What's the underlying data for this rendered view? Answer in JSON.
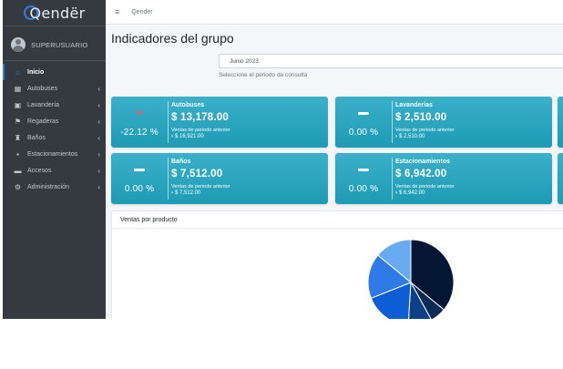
{
  "brand": {
    "name": "Qendër"
  },
  "user": {
    "name": "SUPERUSUARIO"
  },
  "sidebar": {
    "items": [
      {
        "label": "Inicio",
        "icon": "home-icon",
        "glyph": "⌂",
        "active": true,
        "has_children": false
      },
      {
        "label": "Autobuses",
        "icon": "bus-icon",
        "glyph": "▦",
        "active": false,
        "has_children": true
      },
      {
        "label": "Lavandería",
        "icon": "washer-icon",
        "glyph": "▣",
        "active": false,
        "has_children": true
      },
      {
        "label": "Regaderas",
        "icon": "shower-icon",
        "glyph": "⚑",
        "active": false,
        "has_children": true
      },
      {
        "label": "Baños",
        "icon": "toilet-icon",
        "glyph": "♜",
        "active": false,
        "has_children": true
      },
      {
        "label": "Estacionamientos",
        "icon": "parking-icon",
        "glyph": "▪",
        "active": false,
        "has_children": true
      },
      {
        "label": "Accesos",
        "icon": "ticket-icon",
        "glyph": "▬",
        "active": false,
        "has_children": true
      },
      {
        "label": "Administración",
        "icon": "gears-icon",
        "glyph": "⚙",
        "active": false,
        "has_children": true
      }
    ],
    "chevron": "‹"
  },
  "topbar": {
    "title": "Qender",
    "menu_glyph": "≡"
  },
  "page": {
    "title": "Indicadores del grupo",
    "period_value": "Junio 2023",
    "period_help": "Seleccione el periodo de consulta"
  },
  "cards": [
    {
      "name": "Autobuses",
      "pct": "-22.12 %",
      "trend": "down",
      "amount": "$ 13,178.00",
      "prev_label": "Ventas de periodo anterior",
      "prev_value": "$ 16,921.00"
    },
    {
      "name": "Lavanderías",
      "pct": "0.00 %",
      "trend": "flat",
      "amount": "$ 2,510.00",
      "prev_label": "Ventas de periodo anterior",
      "prev_value": "$ 2,510.00"
    },
    {
      "name": "Baños",
      "pct": "0.00 %",
      "trend": "flat",
      "amount": "$ 7,512.00",
      "prev_label": "Ventas de periodo anterior",
      "prev_value": "$ 7,512.00"
    },
    {
      "name": "Estacionamientos",
      "pct": "0.00 %",
      "trend": "flat",
      "amount": "$ 6,942.00",
      "prev_label": "Ventas de periodo anterior",
      "prev_value": "$ 6,942.00"
    }
  ],
  "sales_chart": {
    "title": "Ventas por producto",
    "type": "pie",
    "slices": [
      {
        "value": 36,
        "color": "#031633"
      },
      {
        "value": 6,
        "color": "#0a2b57"
      },
      {
        "value": 9,
        "color": "#0c3f86"
      },
      {
        "value": 18,
        "color": "#0d5ed6"
      },
      {
        "value": 17,
        "color": "#2e7ae6"
      },
      {
        "value": 14,
        "color": "#6aaaf1"
      }
    ]
  },
  "colors": {
    "accent": "#2f7fe0",
    "card": "#1fa2bb",
    "sidebar": "#343a40",
    "negative": "#e35d6a"
  }
}
